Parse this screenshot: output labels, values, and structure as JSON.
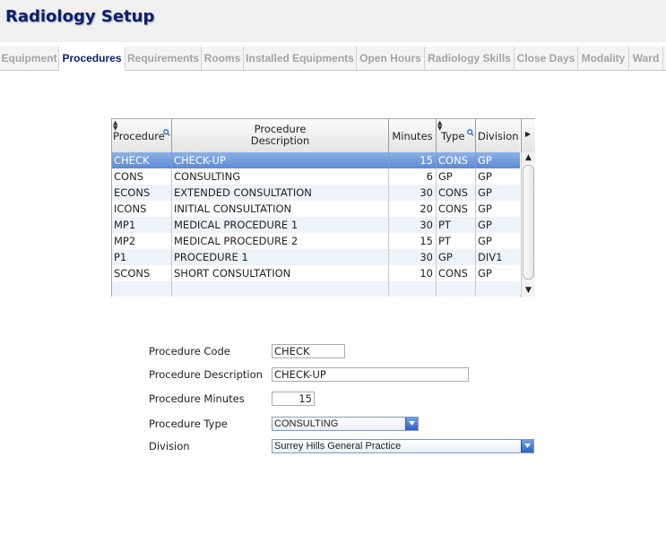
{
  "header": {
    "title": "Radiology Setup"
  },
  "tabs": [
    {
      "label": "Equipment",
      "active": false
    },
    {
      "label": "Procedures",
      "active": true
    },
    {
      "label": "Requirements",
      "active": false
    },
    {
      "label": "Rooms",
      "active": false
    },
    {
      "label": "Installed Equipments",
      "active": false
    },
    {
      "label": "Open Hours",
      "active": false
    },
    {
      "label": "Radiology Skills",
      "active": false
    },
    {
      "label": "Close Days",
      "active": false
    },
    {
      "label": "Modality",
      "active": false
    },
    {
      "label": "Ward",
      "active": false
    }
  ],
  "grid": {
    "columns": [
      {
        "key": "code",
        "label": "Procedure"
      },
      {
        "key": "desc",
        "label_line1": "Procedure",
        "label_line2": "Description"
      },
      {
        "key": "minutes",
        "label": "Minutes"
      },
      {
        "key": "type",
        "label": "Type"
      },
      {
        "key": "division",
        "label": "Division"
      }
    ],
    "rows": [
      {
        "code": "CHECK",
        "desc": "CHECK-UP",
        "minutes": "15",
        "type": "CONS",
        "division": "GP",
        "selected": true
      },
      {
        "code": "CONS",
        "desc": "CONSULTING",
        "minutes": "6",
        "type": "GP",
        "division": "GP"
      },
      {
        "code": "ECONS",
        "desc": "EXTENDED CONSULTATION",
        "minutes": "30",
        "type": "CONS",
        "division": "GP"
      },
      {
        "code": "ICONS",
        "desc": "INITIAL CONSULTATION",
        "minutes": "20",
        "type": "CONS",
        "division": "GP"
      },
      {
        "code": "MP1",
        "desc": "MEDICAL PROCEDURE 1",
        "minutes": "30",
        "type": "PT",
        "division": "GP"
      },
      {
        "code": "MP2",
        "desc": "MEDICAL PROCEDURE 2",
        "minutes": "15",
        "type": "PT",
        "division": "GP"
      },
      {
        "code": "P1",
        "desc": "PROCEDURE 1",
        "minutes": "30",
        "type": "GP",
        "division": "DIV1"
      },
      {
        "code": "SCONS",
        "desc": "SHORT CONSULTATION",
        "minutes": "10",
        "type": "CONS",
        "division": "GP"
      }
    ]
  },
  "form": {
    "code_label": "Procedure Code",
    "code_value": "CHECK",
    "desc_label": "Procedure Description",
    "desc_value": "CHECK-UP",
    "minutes_label": "Procedure Minutes",
    "minutes_value": "15",
    "type_label": "Procedure Type",
    "type_value": "CONSULTING",
    "division_label": "Division",
    "division_value": "Surrey Hills General Practice"
  },
  "colors": {
    "title": "#0d1f6b",
    "tab_active": "#0d1f6b",
    "tab_inactive": "#a3a3a3",
    "row_selected": "#6f97da",
    "row_alt": "#edf3fb"
  }
}
